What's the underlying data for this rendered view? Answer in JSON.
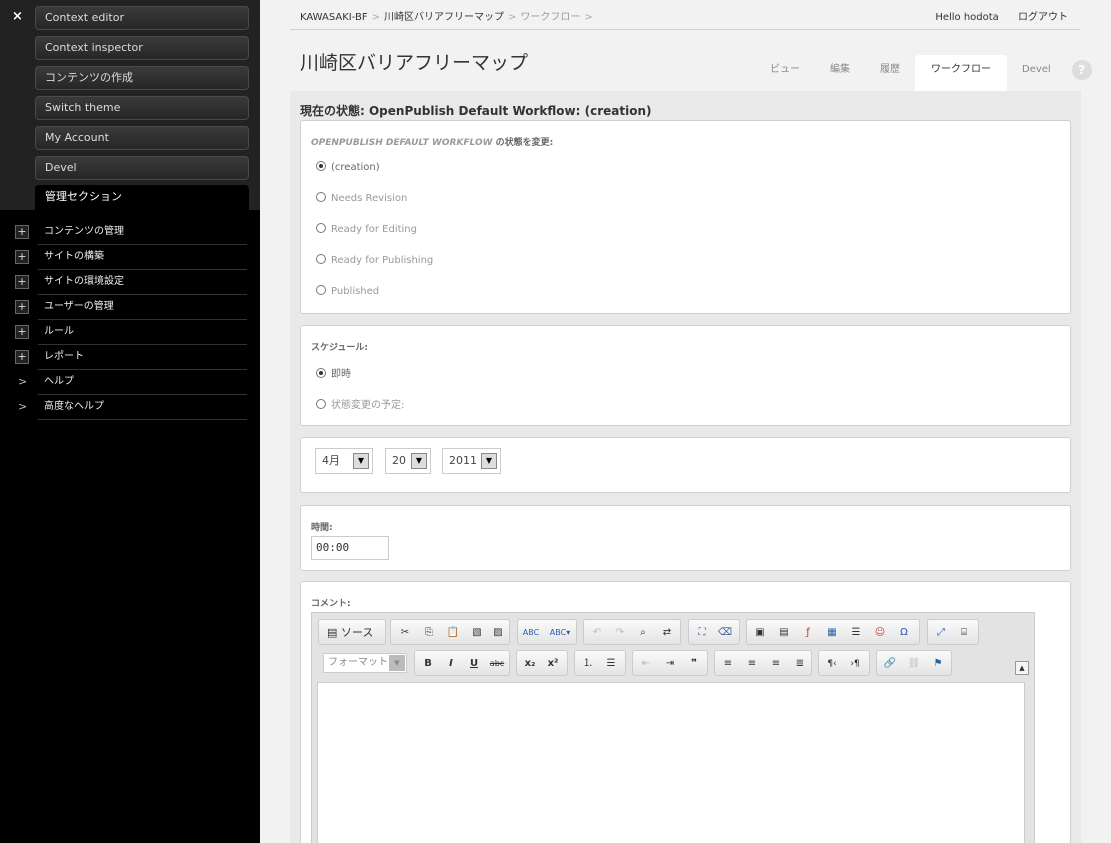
{
  "admin": {
    "close_icon": "×",
    "tabs": [
      "Context editor",
      "Context inspector",
      "コンテンツの作成",
      "Switch theme",
      "My Account",
      "Devel",
      "管理セクション"
    ],
    "menu": [
      {
        "label": "コンテンツの管理",
        "icon": "+"
      },
      {
        "label": "サイトの構築",
        "icon": "+"
      },
      {
        "label": "サイトの環境設定",
        "icon": "+"
      },
      {
        "label": "ユーザーの管理",
        "icon": "+"
      },
      {
        "label": "ルール",
        "icon": "+"
      },
      {
        "label": "レポート",
        "icon": "+"
      },
      {
        "label": "ヘルプ",
        "icon": ">"
      },
      {
        "label": "高度なヘルプ",
        "icon": ">"
      }
    ]
  },
  "breadcrumb": [
    "KAWASAKI-BF",
    "川崎区バリアフリーマップ",
    "ワークフロー"
  ],
  "breadcrumb_sep": ">",
  "user": {
    "greeting": "Hello hodota",
    "logout": "ログアウト"
  },
  "page_title": "川崎区バリアフリーマップ",
  "tabs": [
    "ビュー",
    "編集",
    "履歴",
    "ワークフロー",
    "Devel"
  ],
  "help_icon": "?",
  "state_heading": "現在の状態: OpenPublish Default Workflow: (creation)",
  "workflow": {
    "legend_prefix": "OPENPUBLISH DEFAULT WORKFLOW",
    "legend_suffix": " の状態を変更:",
    "options": [
      "(creation)",
      "Needs Revision",
      "Ready for Editing",
      "Ready for Publishing",
      "Published"
    ],
    "selected": "(creation)"
  },
  "schedule": {
    "legend": "スケジュール:",
    "options": [
      "即時",
      "状態変更の予定:"
    ],
    "selected": "即時"
  },
  "date": {
    "month": "4月",
    "day": "20",
    "year": "2011"
  },
  "time": {
    "label": "時間:",
    "value": "00:00"
  },
  "comment": {
    "label": "コメント:",
    "source_label": "ソース",
    "format_placeholder": "フォーマット"
  },
  "toolbar_icons": {
    "row1": [
      "cut",
      "copy",
      "paste",
      "paste-text",
      "paste-word",
      "spellcheck",
      "spellcheck-as-you-type",
      "undo",
      "redo",
      "find",
      "replace",
      "select-all",
      "remove-format",
      "image",
      "flash",
      "iframe",
      "table",
      "horizontal-rule",
      "smiley",
      "special-char",
      "maximize",
      "show-blocks"
    ],
    "row2": [
      "bold",
      "italic",
      "underline",
      "strike",
      "subscript",
      "superscript",
      "numbered-list",
      "bulleted-list",
      "outdent",
      "indent",
      "blockquote",
      "align-left",
      "align-center",
      "align-right",
      "justify",
      "ltr",
      "rtl",
      "link",
      "unlink",
      "anchor"
    ]
  }
}
